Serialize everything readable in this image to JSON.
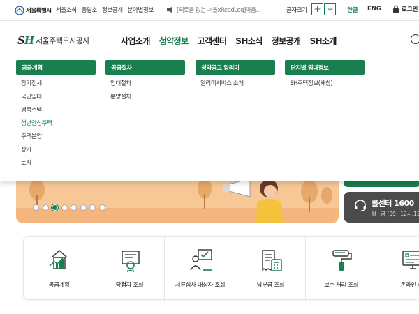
{
  "topbar": {
    "seoul_logo": "서울특별시",
    "links": [
      "서울소식",
      "응답소",
      "정보공개",
      "분야별정보"
    ],
    "notice": "[외로움 없는 서울xReadLog]마음...",
    "font_size_label": "글자크기",
    "font_plus": "+",
    "font_minus": "−",
    "lang_ko": "한글",
    "lang_en": "ENG",
    "login": "로그인"
  },
  "header": {
    "logo_mark_s": "S",
    "logo_mark_h": "H",
    "logo_name": "서울주택도시공사",
    "nav": [
      "사업소개",
      "청약정보",
      "고객센터",
      "SH소식",
      "정보공개",
      "SH소개"
    ],
    "active_nav_index": 1
  },
  "mega_menu": {
    "columns": [
      {
        "title": "공급계획",
        "items": [
          "장기전세",
          "국민임대",
          "행복주택",
          "청년안심주택",
          "주택분양",
          "상가",
          "토지"
        ],
        "current_index": 3
      },
      {
        "title": "공급절차",
        "items": [
          "임대절차",
          "분양절차"
        ]
      },
      {
        "title": "청약공고 알리미",
        "items": [
          "알리미서비스 소개"
        ]
      },
      {
        "title": "단지별 임대정보",
        "items": [
          "SH주택정보(새창)"
        ]
      }
    ]
  },
  "hero": {
    "active_dot_index": 2,
    "dot_count": 8
  },
  "callcenter": {
    "title": "콜센터 1600",
    "hours": "월~금 (09~12시,13"
  },
  "quick_menu": {
    "items": [
      {
        "label": "공급계획",
        "icon": "building-chart-icon"
      },
      {
        "label": "당첨자 조회",
        "icon": "certificate-icon"
      },
      {
        "label": "서류심사 대상자 조회",
        "icon": "person-board-icon"
      },
      {
        "label": "납부금 조회",
        "icon": "receipt-calculator-icon"
      },
      {
        "label": "보수 처리 조회",
        "icon": "paint-roller-icon"
      },
      {
        "label": "온라인 신",
        "icon": "monitor-form-icon"
      }
    ]
  },
  "colors": {
    "brand_green": "#1a7f4e",
    "hero_orange": "#f7c896",
    "callbox_gray": "#4b4b4b"
  }
}
